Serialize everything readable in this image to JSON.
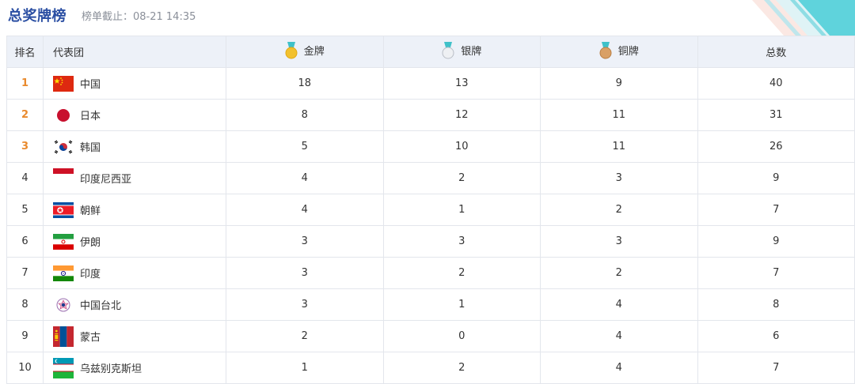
{
  "header": {
    "title": "总奖牌榜",
    "cutoff": "榜单截止：08-21 14:35"
  },
  "table": {
    "headers": {
      "rank": "排名",
      "team": "代表团",
      "gold": "金牌",
      "silver": "银牌",
      "bronze": "铜牌",
      "total": "总数"
    },
    "rows": [
      {
        "rank": "1",
        "name": "中国",
        "flag": "china-flag-icon",
        "gold": "18",
        "silver": "13",
        "bronze": "9",
        "total": "40"
      },
      {
        "rank": "2",
        "name": "日本",
        "flag": "japan-flag-icon",
        "gold": "8",
        "silver": "12",
        "bronze": "11",
        "total": "31"
      },
      {
        "rank": "3",
        "name": "韩国",
        "flag": "korea-flag-icon",
        "gold": "5",
        "silver": "10",
        "bronze": "11",
        "total": "26"
      },
      {
        "rank": "4",
        "name": "印度尼西亚",
        "flag": "indonesia-flag-icon",
        "gold": "4",
        "silver": "2",
        "bronze": "3",
        "total": "9"
      },
      {
        "rank": "5",
        "name": "朝鲜",
        "flag": "north-korea-flag-icon",
        "gold": "4",
        "silver": "1",
        "bronze": "2",
        "total": "7"
      },
      {
        "rank": "6",
        "name": "伊朗",
        "flag": "iran-flag-icon",
        "gold": "3",
        "silver": "3",
        "bronze": "3",
        "total": "9"
      },
      {
        "rank": "7",
        "name": "印度",
        "flag": "india-flag-icon",
        "gold": "3",
        "silver": "2",
        "bronze": "2",
        "total": "7"
      },
      {
        "rank": "8",
        "name": "中国台北",
        "flag": "chinese-taipei-flag-icon",
        "gold": "3",
        "silver": "1",
        "bronze": "4",
        "total": "8"
      },
      {
        "rank": "9",
        "name": "蒙古",
        "flag": "mongolia-flag-icon",
        "gold": "2",
        "silver": "0",
        "bronze": "4",
        "total": "6"
      },
      {
        "rank": "10",
        "name": "乌兹别克斯坦",
        "flag": "uzbekistan-flag-icon",
        "gold": "1",
        "silver": "2",
        "bronze": "4",
        "total": "7"
      }
    ]
  },
  "colors": {
    "title": "#2b4fa3",
    "top3_rank": "#e98a2d",
    "header_bg": "#edf1f8",
    "gold": "#f2c12e",
    "silver": "#d9dde3",
    "bronze": "#d9a066",
    "ribbon": "#3fc1c9"
  }
}
